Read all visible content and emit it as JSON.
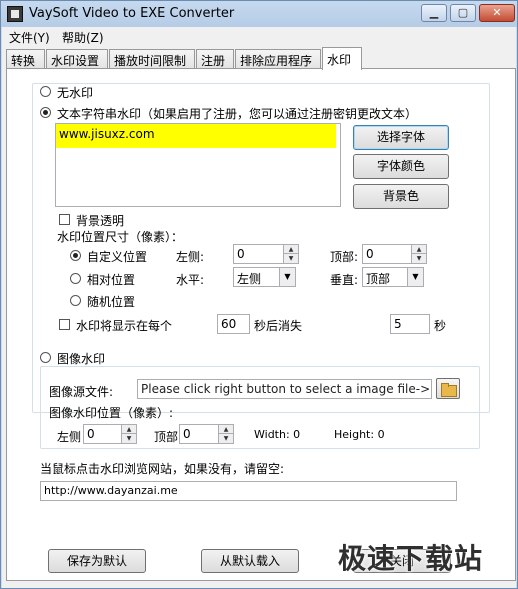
{
  "window": {
    "title": "VaySoft Video to EXE Converter",
    "min": "▁",
    "max": "▢",
    "close": "✕"
  },
  "menu": [
    "文件(Y)",
    "帮助(Z)"
  ],
  "tabs": [
    "转换",
    "水印设置",
    "播放时间限制",
    "注册",
    "排除应用程序",
    "水印"
  ],
  "no_watermark": "无水印",
  "text_watermark": "文本字符串水印（如果启用了注册，您可以通过注册密钥更改文本）",
  "watermark_text": "www.jisuxz.com",
  "highlight_color": "#ffff00",
  "buttons": {
    "select_font": "选择字体",
    "font_color": "字体颜色",
    "bg_color": "背景色",
    "save_default": "保存为默认",
    "load_default": "从默认载入",
    "close": "关闭"
  },
  "transparent_bg": "背景透明",
  "text_position_label": "水印位置尺寸（像素）：",
  "custom_position": "自定义位置",
  "left_label": "左侧:",
  "left_value": "0",
  "top_label": "顶部:",
  "top_value": "0",
  "relative_position": "相对位置",
  "horizontal_label": "水平:",
  "horizontal_value": "左侧",
  "vertical_label": "垂直:",
  "vertical_value": "顶部",
  "random_position": "随机位置",
  "show_every": "水印将显示在每个",
  "interval_value": "60",
  "seconds_after": "秒后消失",
  "duration_value": "5",
  "seconds": "秒",
  "image_watermark": "图像水印",
  "image_source_label": "图像源文件:",
  "image_source_placeholder": "Please click right button to select a image file->",
  "image_position_label": "图像水印位置（像素）:",
  "img_left_label": "左侧",
  "img_left_value": "0",
  "img_top_label": "顶部",
  "img_top_value": "0",
  "width_text": "Width: 0",
  "height_text": "Height: 0",
  "click_url_label": "当鼠标点击水印浏览网站，如果没有，请留空:",
  "click_url_value": "http://www.dayanzai.me",
  "site_watermark": "极速下载站"
}
